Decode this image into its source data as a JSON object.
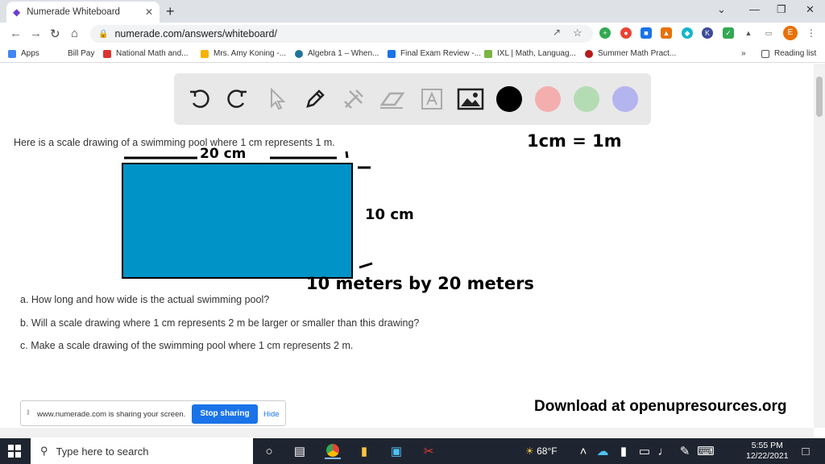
{
  "browser": {
    "tab_title": "Numerade Whiteboard",
    "url": "numerade.com/answers/whiteboard/",
    "profile_initial": "E"
  },
  "bookmarks": [
    {
      "label": "Apps"
    },
    {
      "label": "Bill Pay"
    },
    {
      "label": "National Math and..."
    },
    {
      "label": "Mrs. Amy Koning -..."
    },
    {
      "label": "Algebra 1 – When..."
    },
    {
      "label": "Final Exam Review -..."
    },
    {
      "label": "IXL | Math, Languag..."
    },
    {
      "label": "Summer Math Pract..."
    }
  ],
  "reading_list": "Reading list",
  "whiteboard": {
    "tools": [
      "undo-icon",
      "redo-icon",
      "pointer-icon",
      "pen-icon",
      "tools-icon",
      "eraser-icon",
      "text-icon",
      "image-icon"
    ],
    "colors": [
      "#000000",
      "#f4aeae",
      "#b4dcb4",
      "#b4b4ee"
    ]
  },
  "problem": {
    "header": "Here is a scale drawing of a swimming pool where 1 cm represents 1 m.",
    "q_a": "a. How long and how wide is the actual swimming pool?",
    "q_b": "b. Will a scale drawing where 1 cm represents 2 m be larger or smaller than this drawing?",
    "q_c": "c. Make a scale drawing of the swimming pool where 1 cm represents 2 m."
  },
  "handwriting": {
    "scale": "1cm = 1m",
    "top_label": "20 cm",
    "side_label": "10 cm",
    "answer": "10 meters by 20 meters"
  },
  "download_text": "Download at openupresources.org",
  "share_bar": {
    "message": "www.numerade.com is sharing your screen.",
    "stop": "Stop sharing",
    "hide": "Hide"
  },
  "taskbar": {
    "search_placeholder": "Type here to search",
    "weather": "68°F",
    "time": "5:55 PM",
    "date": "12/22/2021"
  }
}
